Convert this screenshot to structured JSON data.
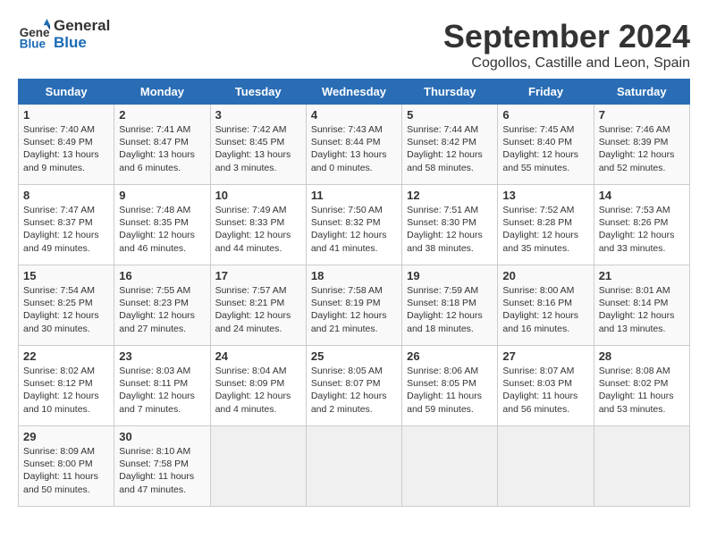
{
  "header": {
    "logo_line1": "General",
    "logo_line2": "Blue",
    "month": "September 2024",
    "location": "Cogollos, Castille and Leon, Spain"
  },
  "weekdays": [
    "Sunday",
    "Monday",
    "Tuesday",
    "Wednesday",
    "Thursday",
    "Friday",
    "Saturday"
  ],
  "weeks": [
    [
      {
        "day": "1",
        "sunrise": "7:40 AM",
        "sunset": "8:49 PM",
        "daylight": "13 hours and 9 minutes."
      },
      {
        "day": "2",
        "sunrise": "7:41 AM",
        "sunset": "8:47 PM",
        "daylight": "13 hours and 6 minutes."
      },
      {
        "day": "3",
        "sunrise": "7:42 AM",
        "sunset": "8:45 PM",
        "daylight": "13 hours and 3 minutes."
      },
      {
        "day": "4",
        "sunrise": "7:43 AM",
        "sunset": "8:44 PM",
        "daylight": "13 hours and 0 minutes."
      },
      {
        "day": "5",
        "sunrise": "7:44 AM",
        "sunset": "8:42 PM",
        "daylight": "12 hours and 58 minutes."
      },
      {
        "day": "6",
        "sunrise": "7:45 AM",
        "sunset": "8:40 PM",
        "daylight": "12 hours and 55 minutes."
      },
      {
        "day": "7",
        "sunrise": "7:46 AM",
        "sunset": "8:39 PM",
        "daylight": "12 hours and 52 minutes."
      }
    ],
    [
      {
        "day": "8",
        "sunrise": "7:47 AM",
        "sunset": "8:37 PM",
        "daylight": "12 hours and 49 minutes."
      },
      {
        "day": "9",
        "sunrise": "7:48 AM",
        "sunset": "8:35 PM",
        "daylight": "12 hours and 46 minutes."
      },
      {
        "day": "10",
        "sunrise": "7:49 AM",
        "sunset": "8:33 PM",
        "daylight": "12 hours and 44 minutes."
      },
      {
        "day": "11",
        "sunrise": "7:50 AM",
        "sunset": "8:32 PM",
        "daylight": "12 hours and 41 minutes."
      },
      {
        "day": "12",
        "sunrise": "7:51 AM",
        "sunset": "8:30 PM",
        "daylight": "12 hours and 38 minutes."
      },
      {
        "day": "13",
        "sunrise": "7:52 AM",
        "sunset": "8:28 PM",
        "daylight": "12 hours and 35 minutes."
      },
      {
        "day": "14",
        "sunrise": "7:53 AM",
        "sunset": "8:26 PM",
        "daylight": "12 hours and 33 minutes."
      }
    ],
    [
      {
        "day": "15",
        "sunrise": "7:54 AM",
        "sunset": "8:25 PM",
        "daylight": "12 hours and 30 minutes."
      },
      {
        "day": "16",
        "sunrise": "7:55 AM",
        "sunset": "8:23 PM",
        "daylight": "12 hours and 27 minutes."
      },
      {
        "day": "17",
        "sunrise": "7:57 AM",
        "sunset": "8:21 PM",
        "daylight": "12 hours and 24 minutes."
      },
      {
        "day": "18",
        "sunrise": "7:58 AM",
        "sunset": "8:19 PM",
        "daylight": "12 hours and 21 minutes."
      },
      {
        "day": "19",
        "sunrise": "7:59 AM",
        "sunset": "8:18 PM",
        "daylight": "12 hours and 18 minutes."
      },
      {
        "day": "20",
        "sunrise": "8:00 AM",
        "sunset": "8:16 PM",
        "daylight": "12 hours and 16 minutes."
      },
      {
        "day": "21",
        "sunrise": "8:01 AM",
        "sunset": "8:14 PM",
        "daylight": "12 hours and 13 minutes."
      }
    ],
    [
      {
        "day": "22",
        "sunrise": "8:02 AM",
        "sunset": "8:12 PM",
        "daylight": "12 hours and 10 minutes."
      },
      {
        "day": "23",
        "sunrise": "8:03 AM",
        "sunset": "8:11 PM",
        "daylight": "12 hours and 7 minutes."
      },
      {
        "day": "24",
        "sunrise": "8:04 AM",
        "sunset": "8:09 PM",
        "daylight": "12 hours and 4 minutes."
      },
      {
        "day": "25",
        "sunrise": "8:05 AM",
        "sunset": "8:07 PM",
        "daylight": "12 hours and 2 minutes."
      },
      {
        "day": "26",
        "sunrise": "8:06 AM",
        "sunset": "8:05 PM",
        "daylight": "11 hours and 59 minutes."
      },
      {
        "day": "27",
        "sunrise": "8:07 AM",
        "sunset": "8:03 PM",
        "daylight": "11 hours and 56 minutes."
      },
      {
        "day": "28",
        "sunrise": "8:08 AM",
        "sunset": "8:02 PM",
        "daylight": "11 hours and 53 minutes."
      }
    ],
    [
      {
        "day": "29",
        "sunrise": "8:09 AM",
        "sunset": "8:00 PM",
        "daylight": "11 hours and 50 minutes."
      },
      {
        "day": "30",
        "sunrise": "8:10 AM",
        "sunset": "7:58 PM",
        "daylight": "11 hours and 47 minutes."
      },
      null,
      null,
      null,
      null,
      null
    ]
  ]
}
